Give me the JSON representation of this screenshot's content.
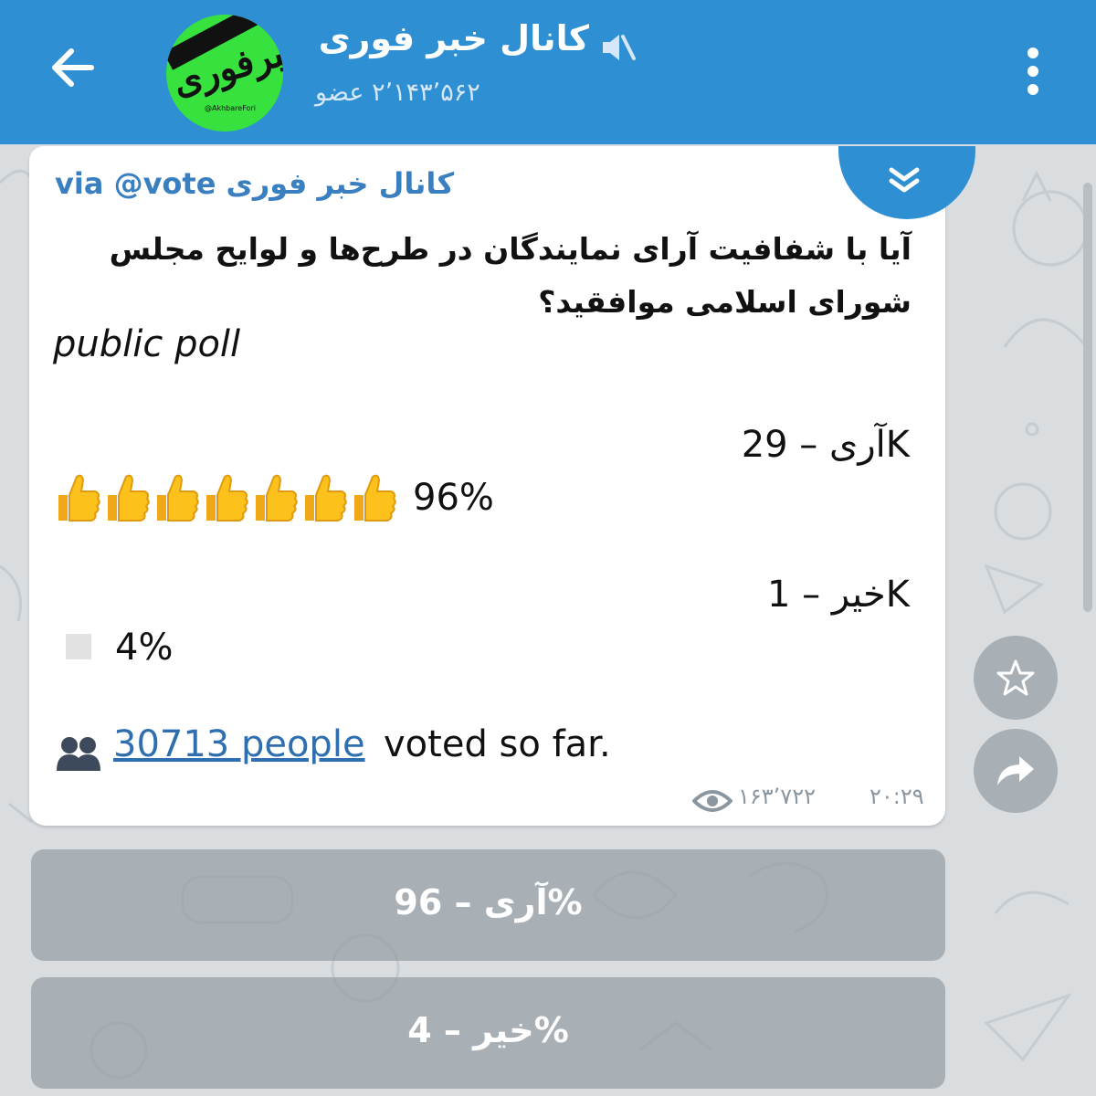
{
  "header": {
    "channel_title": "کانال خبر فوری",
    "member_count": "۲٬۱۴۳٬۵۶۲ عضو",
    "avatar_logo_text": "خبرفوری",
    "avatar_logo_sub": "@AkhbareFori"
  },
  "message": {
    "sender_name": "کانال خبر فوری",
    "via_bot": "via @vote",
    "question": "آیا با شفافیت آرای نمایندگان در طرح‌ها و لوایح مجلس شورای اسلامی موافقید؟",
    "poll_type": "public poll",
    "options": [
      {
        "label": "آری – 29K",
        "percent": "96%",
        "percent_value": 96,
        "thumb_count": 7
      },
      {
        "label": "خیر – 1K",
        "percent": "4%",
        "percent_value": 4
      }
    ],
    "voters_link": "30713 people",
    "voters_rest": "voted so far.",
    "views": "۱۶۳٬۷۲۲",
    "time": "۲۰:۲۹"
  },
  "keyboard": {
    "buttons": [
      "آری – 96%",
      "خیر – 4%"
    ]
  },
  "icons": {
    "back": "arrow-left-icon",
    "mute": "muted-speaker-icon",
    "menu": "more-vertical-icon",
    "collapse": "double-chevron-down-icon",
    "voters": "people-icon",
    "views": "eye-icon",
    "star": "star-icon",
    "share": "share-arrow-icon"
  },
  "colors": {
    "header": "#2f8fd3",
    "link": "#2f6fb0",
    "avatar_bg": "#37e23f"
  }
}
